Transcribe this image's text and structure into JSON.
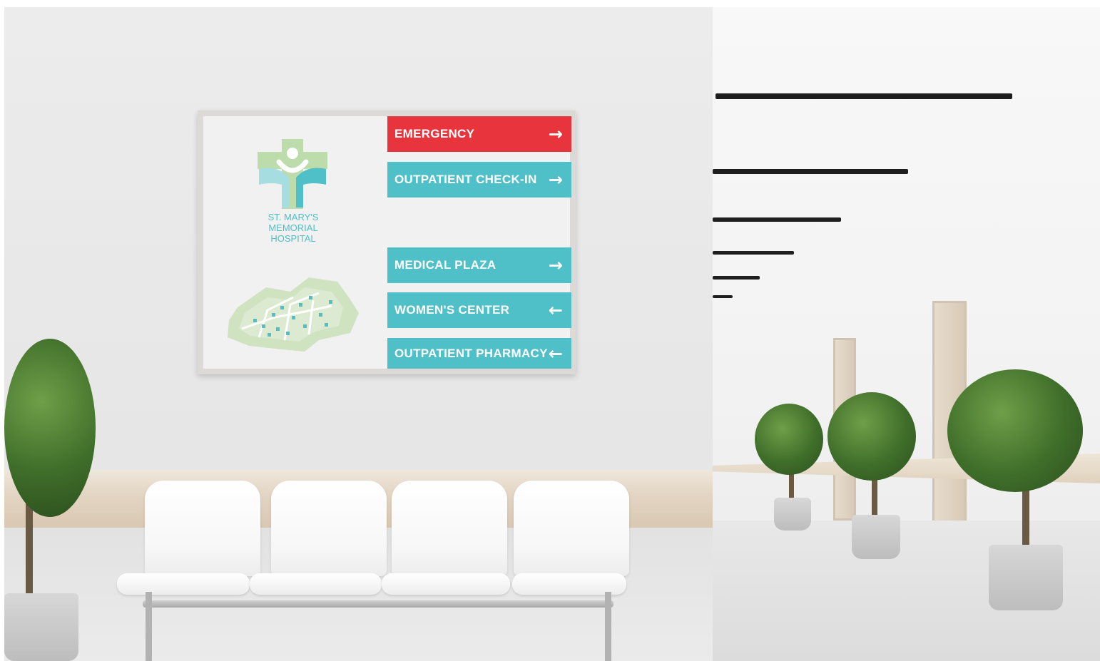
{
  "sign": {
    "logo_text": [
      "ST. MARY'S",
      "MEMORIAL",
      "HOSPITAL"
    ],
    "directions": [
      {
        "label": "EMERGENCY",
        "arrow": "→",
        "direction": "right",
        "color": "#e8353d"
      },
      {
        "label": "OUTPATIENT CHECK-IN",
        "arrow": "→",
        "direction": "right",
        "color": "#4fc0c7"
      },
      {
        "label": "MEDICAL PLAZA",
        "arrow": "→",
        "direction": "right",
        "color": "#4fc0c7"
      },
      {
        "label": "WOMEN'S CENTER",
        "arrow": "←",
        "direction": "left",
        "color": "#4fc0c7"
      },
      {
        "label": "OUTPATIENT PHARMACY",
        "arrow": "←",
        "direction": "left",
        "color": "#4fc0c7"
      }
    ]
  },
  "colors": {
    "emergency_red": "#e8353d",
    "teal": "#4fc0c7",
    "logo_green": "#b9d9a8",
    "wall": "#e8e8e8",
    "wood": "#dccbb5",
    "foliage": "#3f6e2a"
  },
  "icons": [
    "hospital-cross-logo-icon",
    "campus-map-icon",
    "arrow-right-icon",
    "arrow-left-icon"
  ]
}
